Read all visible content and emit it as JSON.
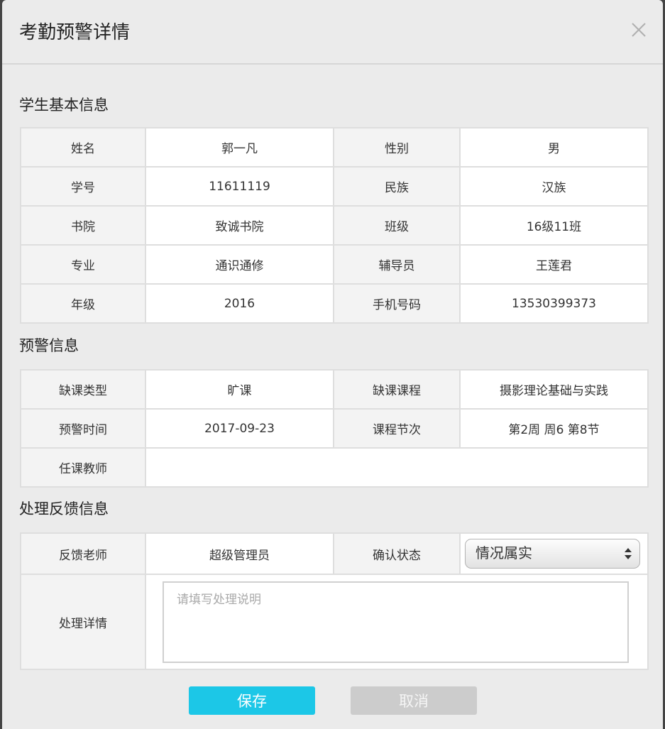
{
  "dialog": {
    "title": "考勤预警详情",
    "close_icon": "close-icon"
  },
  "student_info": {
    "title": "学生基本信息",
    "rows": [
      {
        "label_a": "姓名",
        "value_a": "郭一凡",
        "label_b": "性别",
        "value_b": "男"
      },
      {
        "label_a": "学号",
        "value_a": "11611119",
        "label_b": "民族",
        "value_b": "汉族"
      },
      {
        "label_a": "书院",
        "value_a": "致诚书院",
        "label_b": "班级",
        "value_b": "16级11班"
      },
      {
        "label_a": "专业",
        "value_a": "通识通修",
        "label_b": "辅导员",
        "value_b": "王莲君"
      },
      {
        "label_a": "年级",
        "value_a": "2016",
        "label_b": "手机号码",
        "value_b": "13530399373"
      }
    ]
  },
  "warning_info": {
    "title": "预警信息",
    "rows": [
      {
        "label_a": "缺课类型",
        "value_a": "旷课",
        "label_b": "缺课课程",
        "value_b": "摄影理论基础与实践"
      },
      {
        "label_a": "预警时间",
        "value_a": "2017-09-23",
        "label_b": "课程节次",
        "value_b": "第2周 周6 第8节"
      }
    ],
    "teacher_label": "任课教师"
  },
  "feedback": {
    "title": "处理反馈信息",
    "teacher_label": "反馈老师",
    "teacher_value": "超级管理员",
    "status_label": "确认状态",
    "status_value": "情况属实",
    "status_icon": "select-arrows-icon",
    "detail_label": "处理详情",
    "detail_placeholder": "请填写处理说明"
  },
  "actions": {
    "save_label": "保存",
    "cancel_label": "取消"
  },
  "colors": {
    "dialog_bg": "#ebebeb",
    "label_cell_bg": "#f3f3f3",
    "value_cell_bg": "#ffffff",
    "border": "#dedede",
    "primary": "#1cc7e7",
    "secondary": "#cccccc"
  }
}
